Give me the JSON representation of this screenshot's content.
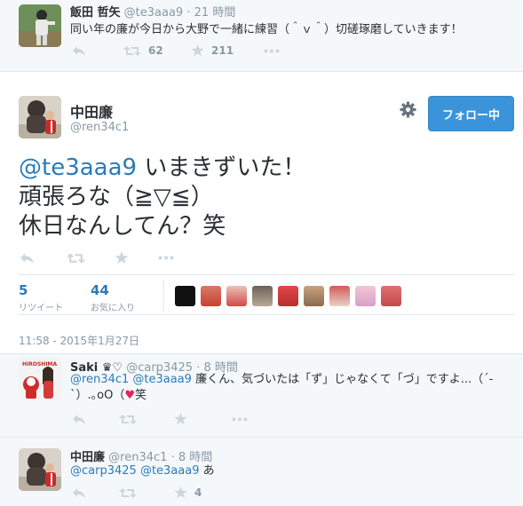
{
  "context_tweet": {
    "name": "飯田 哲矢",
    "handle": "@te3aaa9",
    "separator": "·",
    "time": "21 時間",
    "text": "同い年の廉が今日から大野で一緒に練習（＾ｖ＾）切磋琢磨していきます！",
    "retweet_count": "62",
    "favorite_count": "211"
  },
  "main_tweet": {
    "name": "中田廉",
    "handle": "@ren34c1",
    "follow_label": "フォロー中",
    "mention": "@te3aaa9",
    "line1_rest": " いまきずいた！",
    "line2": "頑張ろな（≧▽≦）",
    "line3": "休日なんしてん？笑",
    "retweets": "5",
    "retweets_label": "リツイート",
    "favorites": "44",
    "favorites_label": "お気に入り",
    "timestamp": "11:58 - 2015年1月27日"
  },
  "replies": [
    {
      "name": "Saki ♛♡",
      "handle": "@carp3425",
      "separator": "·",
      "time": "8 時間",
      "mention1": "@ren34c1",
      "mention2": "@te3aaa9",
      "text_before_heart": " 廉くん、気づいたは「ず」じゃなくて「づ」ですよ...（´-`）.｡oO（",
      "heart": "♥",
      "text_after_heart": "笑"
    },
    {
      "name": "中田廉",
      "handle": "@ren34c1",
      "separator": "·",
      "time": "8 時間",
      "mention1": "@carp3425",
      "mention2": "@te3aaa9",
      "text_rest": " あ",
      "favorite_count": "4"
    }
  ],
  "colors": {
    "link": "#2b7bb9",
    "follow_button": "#3b94d9",
    "muted": "#8899a6",
    "heart": "#e0245e"
  },
  "icons": [
    "reply-icon",
    "retweet-icon",
    "favorite-icon",
    "more-icon",
    "gear-icon"
  ]
}
